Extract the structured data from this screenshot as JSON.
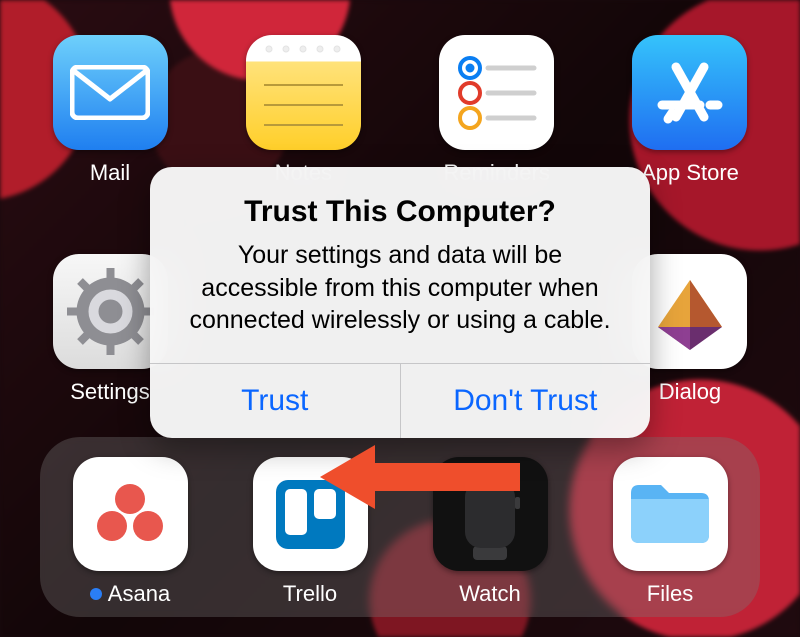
{
  "apps_row1": [
    {
      "label": "Mail",
      "name": "mail",
      "has_dot": false
    },
    {
      "label": "Notes",
      "name": "notes",
      "has_dot": false
    },
    {
      "label": "Reminders",
      "name": "reminders",
      "has_dot": false
    },
    {
      "label": "App Store",
      "name": "appstore",
      "has_dot": false
    }
  ],
  "apps_row2": [
    {
      "label": "Settings",
      "name": "settings",
      "has_dot": false
    },
    {
      "label": "",
      "name": "placeholder1",
      "has_dot": false
    },
    {
      "label": "",
      "name": "placeholder2",
      "has_dot": false
    },
    {
      "label": "Dialog",
      "name": "dialog",
      "has_dot": false
    }
  ],
  "dock": [
    {
      "label": "Asana",
      "name": "asana",
      "has_dot": true
    },
    {
      "label": "Trello",
      "name": "trello",
      "has_dot": false
    },
    {
      "label": "Watch",
      "name": "watch",
      "has_dot": false
    },
    {
      "label": "Files",
      "name": "files",
      "has_dot": false
    }
  ],
  "dialog": {
    "title": "Trust This Computer?",
    "message": "Your settings and data will be accessible from this computer when connected wirelessly or using a cable.",
    "trust_label": "Trust",
    "dont_trust_label": "Don't Trust"
  },
  "colors": {
    "ios_blue": "#0a66ff",
    "arrow_red": "#ef4e2c"
  }
}
